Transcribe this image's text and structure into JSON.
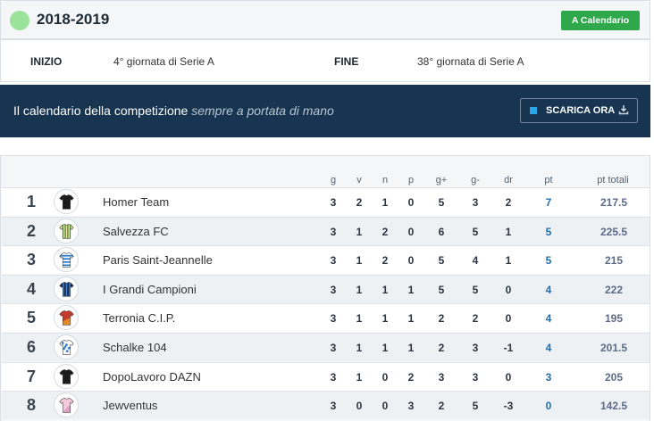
{
  "season": {
    "title": "2018-2019",
    "calendar_button": "A Calendario"
  },
  "dates": {
    "start_label": "INIZIO",
    "start_value": "4° giornata di Serie A",
    "end_label": "FINE",
    "end_value": "38° giornata di Serie A"
  },
  "banner": {
    "text": "Il calendario della competizione",
    "text_italic": "sempre a portata di mano",
    "download_button": "SCARICA ORA"
  },
  "table": {
    "headers": {
      "g": "g",
      "v": "v",
      "n": "n",
      "p": "p",
      "gf": "g+",
      "ga": "g-",
      "dr": "dr",
      "pt": "pt",
      "tot": "pt totali"
    },
    "rows": [
      {
        "pos": "1",
        "team": "Homer Team",
        "g": "3",
        "v": "2",
        "n": "1",
        "p": "0",
        "gf": "5",
        "ga": "3",
        "dr": "2",
        "pt": "7",
        "tot": "217.5",
        "jersey": "black-shirt"
      },
      {
        "pos": "2",
        "team": "Salvezza FC",
        "g": "3",
        "v": "1",
        "n": "2",
        "p": "0",
        "gf": "6",
        "ga": "5",
        "dr": "1",
        "pt": "5",
        "tot": "225.5",
        "jersey": "yellow-green-stripes-shirt"
      },
      {
        "pos": "3",
        "team": "Paris Saint-Jeannelle",
        "g": "3",
        "v": "1",
        "n": "2",
        "p": "0",
        "gf": "5",
        "ga": "4",
        "dr": "1",
        "pt": "5",
        "tot": "215",
        "jersey": "blue-white-hoops-shirt"
      },
      {
        "pos": "4",
        "team": "I Grandi Campioni",
        "g": "3",
        "v": "1",
        "n": "1",
        "p": "1",
        "gf": "5",
        "ga": "5",
        "dr": "0",
        "pt": "4",
        "tot": "222",
        "jersey": "navy-stripes-shirt"
      },
      {
        "pos": "5",
        "team": "Terronia C.I.P.",
        "g": "3",
        "v": "1",
        "n": "1",
        "p": "1",
        "gf": "2",
        "ga": "2",
        "dr": "0",
        "pt": "4",
        "tot": "195",
        "jersey": "red-orange-shirt"
      },
      {
        "pos": "6",
        "team": "Schalke 104",
        "g": "3",
        "v": "1",
        "n": "1",
        "p": "1",
        "gf": "2",
        "ga": "3",
        "dr": "-1",
        "pt": "4",
        "tot": "201.5",
        "jersey": "blue-white-pattern-shirt"
      },
      {
        "pos": "7",
        "team": "DopoLavoro DAZN",
        "g": "3",
        "v": "1",
        "n": "0",
        "p": "2",
        "gf": "3",
        "ga": "3",
        "dr": "0",
        "pt": "3",
        "tot": "205",
        "jersey": "black-shirt"
      },
      {
        "pos": "8",
        "team": "Jewventus",
        "g": "3",
        "v": "0",
        "n": "0",
        "p": "3",
        "gf": "2",
        "ga": "5",
        "dr": "-3",
        "pt": "0",
        "tot": "142.5",
        "jersey": "pink-shirt"
      }
    ]
  },
  "colors": {
    "accent_green": "#2ea84a",
    "banner_bg": "#173450",
    "points_blue": "#1c6fb3"
  }
}
